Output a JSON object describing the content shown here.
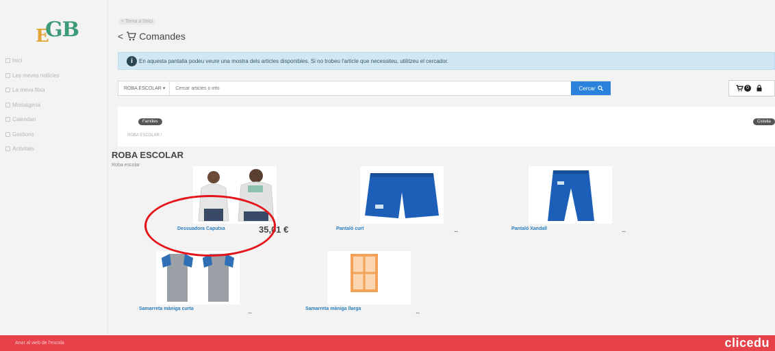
{
  "logo": {
    "letter_e": "E",
    "letters_gb": "GB"
  },
  "sidebar": {
    "items": [
      {
        "label": "Inici",
        "icon": "home-icon"
      },
      {
        "label": "Les meves notícies",
        "icon": "news-icon"
      },
      {
        "label": "La meva fitxa",
        "icon": "profile-icon"
      },
      {
        "label": "Missatgeria",
        "icon": "mail-icon"
      },
      {
        "label": "Calendari",
        "icon": "calendar-icon"
      },
      {
        "label": "Gestions",
        "icon": "tasks-icon"
      },
      {
        "label": "Activitats",
        "icon": "activities-icon"
      }
    ]
  },
  "header": {
    "breadcrumb": "< Torna a l'inici",
    "back": "<",
    "title": "Comandes"
  },
  "banner": {
    "text": "En aquesta pantalla podeu veure una mostra dels articles disponibles. Si no trobeu l'article que necessiteu, utilitzeu el cercador."
  },
  "search": {
    "category": "ROBA ESCOLAR",
    "caret": "▾",
    "placeholder": "Cercar articles o info",
    "button_label": "Cercar",
    "cart_count": "0"
  },
  "families": {
    "left_pill": "Famílies",
    "right_pill": "Cistella",
    "path": "ROBA ESCOLAR /"
  },
  "section": {
    "title": "ROBA ESCOLAR",
    "subtitle": "Roba escolar"
  },
  "products": [
    {
      "name": "Dessuadora Caputxa",
      "price": "35,01 €",
      "dots": ""
    },
    {
      "name": "Pantaló curt",
      "price": "",
      "dots": "..."
    },
    {
      "name": "Pantaló Xandall",
      "price": "",
      "dots": "..."
    },
    {
      "name": "Samarreta màniga curta",
      "price": "",
      "dots": "..."
    },
    {
      "name": "Samarreta màniga llarga",
      "price": "",
      "dots": "..."
    }
  ],
  "footer": {
    "text": "Anar al web de l'escola",
    "brand": "clicedu"
  },
  "colors": {
    "accent_blue": "#2a82dc",
    "banner_bg": "#cfe8f3",
    "footer_red": "#e74149",
    "annotation_red": "#e5141b"
  }
}
